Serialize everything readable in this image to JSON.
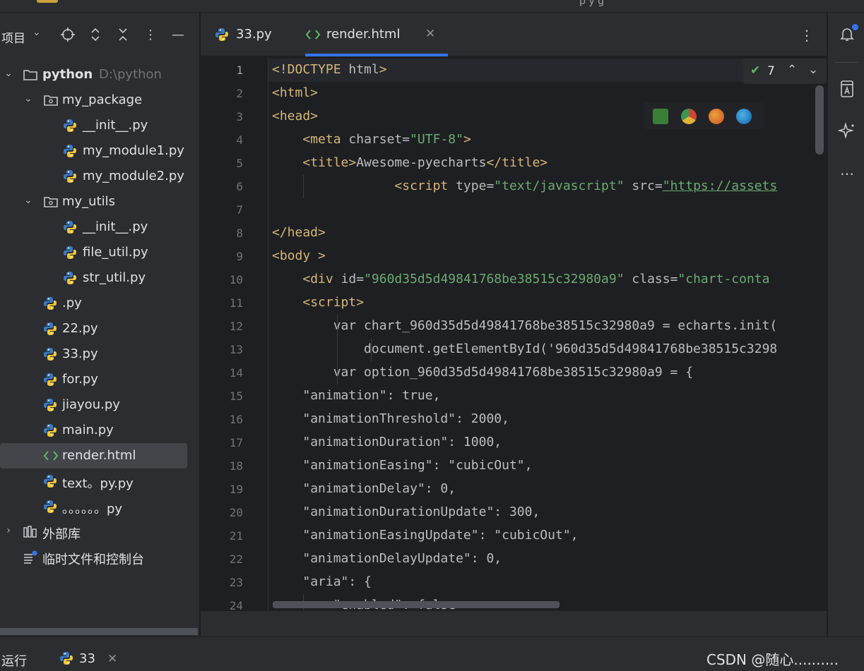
{
  "top_strip": {
    "text": "p  y  g"
  },
  "project_panel": {
    "title": "项目",
    "tree": [
      {
        "label": "python",
        "hint": "D:\\python",
        "type": "folder",
        "depth": 0,
        "expanded": true
      },
      {
        "label": "my_package",
        "type": "package",
        "depth": 1,
        "expanded": true
      },
      {
        "label": "__init__.py",
        "type": "py",
        "depth": 2
      },
      {
        "label": "my_module1.py",
        "type": "py",
        "depth": 2
      },
      {
        "label": "my_module2.py",
        "type": "py",
        "depth": 2
      },
      {
        "label": "my_utils",
        "type": "package",
        "depth": 1,
        "expanded": true
      },
      {
        "label": "__init__.py",
        "type": "py",
        "depth": 2
      },
      {
        "label": "file_util.py",
        "type": "py",
        "depth": 2
      },
      {
        "label": "str_util.py",
        "type": "py",
        "depth": 2
      },
      {
        "label": ".py",
        "type": "py",
        "depth": 1
      },
      {
        "label": "22.py",
        "type": "py",
        "depth": 1
      },
      {
        "label": "33.py",
        "type": "py",
        "depth": 1
      },
      {
        "label": "for.py",
        "type": "py",
        "depth": 1
      },
      {
        "label": "jiayou.py",
        "type": "py",
        "depth": 1
      },
      {
        "label": "main.py",
        "type": "py",
        "depth": 1
      },
      {
        "label": "render.html",
        "type": "html",
        "depth": 1,
        "selected": true
      },
      {
        "label": "text。py.py",
        "type": "py",
        "depth": 1
      },
      {
        "label": "。。。。。。py",
        "type": "py",
        "depth": 1
      },
      {
        "label": "外部库",
        "type": "library",
        "depth": 0,
        "expanded": false
      },
      {
        "label": "临时文件和控制台",
        "type": "scratch",
        "depth": 0
      }
    ]
  },
  "editor": {
    "tabs": [
      {
        "label": "33.py",
        "type": "py",
        "active": false
      },
      {
        "label": "render.html",
        "type": "html",
        "active": true
      }
    ],
    "inspection_count": "7",
    "lines": [
      {
        "n": "1",
        "ind": 0,
        "segs": [
          [
            "tag",
            "<!DOCTYPE "
          ],
          [
            "attr",
            "html"
          ],
          [
            "tag",
            ">"
          ]
        ]
      },
      {
        "n": "2",
        "ind": 0,
        "segs": [
          [
            "tag",
            "<html>"
          ]
        ]
      },
      {
        "n": "3",
        "ind": 0,
        "segs": [
          [
            "tag",
            "<head>"
          ]
        ]
      },
      {
        "n": "4",
        "ind": 4,
        "segs": [
          [
            "tag",
            "<meta "
          ],
          [
            "attr",
            "charset"
          ],
          [
            "plain",
            "="
          ],
          [
            "str",
            "\"UTF-8\""
          ],
          [
            "tag",
            ">"
          ]
        ]
      },
      {
        "n": "5",
        "ind": 4,
        "segs": [
          [
            "tag",
            "<title>"
          ],
          [
            "plain",
            "Awesome-pyecharts"
          ],
          [
            "tag",
            "</title>"
          ]
        ]
      },
      {
        "n": "6",
        "ind": 16,
        "segs": [
          [
            "tag",
            "<script "
          ],
          [
            "attr",
            "type"
          ],
          [
            "plain",
            "="
          ],
          [
            "str",
            "\"text/javascript\""
          ],
          [
            "plain",
            " "
          ],
          [
            "attr",
            "src"
          ],
          [
            "plain",
            "="
          ],
          [
            "lnk",
            "\"https://assets"
          ]
        ]
      },
      {
        "n": "7",
        "ind": 0,
        "segs": []
      },
      {
        "n": "8",
        "ind": 0,
        "segs": [
          [
            "tag",
            "</head>"
          ]
        ]
      },
      {
        "n": "9",
        "ind": 0,
        "segs": [
          [
            "tag",
            "<body "
          ],
          [
            "tag",
            ">"
          ]
        ]
      },
      {
        "n": "10",
        "ind": 4,
        "segs": [
          [
            "tag",
            "<div "
          ],
          [
            "attr",
            "id"
          ],
          [
            "plain",
            "="
          ],
          [
            "str",
            "\"960d35d5d49841768be38515c32980a9\""
          ],
          [
            "plain",
            " "
          ],
          [
            "attr",
            "class"
          ],
          [
            "plain",
            "="
          ],
          [
            "str",
            "\"chart-conta"
          ]
        ]
      },
      {
        "n": "11",
        "ind": 4,
        "segs": [
          [
            "tag",
            "<script>"
          ]
        ]
      },
      {
        "n": "12",
        "ind": 8,
        "segs": [
          [
            "plain",
            "var chart_960d35d5d49841768be38515c32980a9 = echarts.init("
          ]
        ]
      },
      {
        "n": "13",
        "ind": 12,
        "segs": [
          [
            "plain",
            "document.getElementById('960d35d5d49841768be38515c3298"
          ]
        ]
      },
      {
        "n": "14",
        "ind": 8,
        "segs": [
          [
            "plain",
            "var option_960d35d5d49841768be38515c32980a9 = {"
          ]
        ]
      },
      {
        "n": "15",
        "ind": 4,
        "segs": [
          [
            "plain",
            "\"animation\": true,"
          ]
        ]
      },
      {
        "n": "16",
        "ind": 4,
        "segs": [
          [
            "plain",
            "\"animationThreshold\": 2000,"
          ]
        ]
      },
      {
        "n": "17",
        "ind": 4,
        "segs": [
          [
            "plain",
            "\"animationDuration\": 1000,"
          ]
        ]
      },
      {
        "n": "18",
        "ind": 4,
        "segs": [
          [
            "plain",
            "\"animationEasing\": \"cubicOut\","
          ]
        ]
      },
      {
        "n": "19",
        "ind": 4,
        "segs": [
          [
            "plain",
            "\"animationDelay\": 0,"
          ]
        ]
      },
      {
        "n": "20",
        "ind": 4,
        "segs": [
          [
            "plain",
            "\"animationDurationUpdate\": 300,"
          ]
        ]
      },
      {
        "n": "21",
        "ind": 4,
        "segs": [
          [
            "plain",
            "\"animationEasingUpdate\": \"cubicOut\","
          ]
        ]
      },
      {
        "n": "22",
        "ind": 4,
        "segs": [
          [
            "plain",
            "\"animationDelayUpdate\": 0,"
          ]
        ]
      },
      {
        "n": "23",
        "ind": 4,
        "segs": [
          [
            "plain",
            "\"aria\": {"
          ]
        ]
      },
      {
        "n": "24",
        "ind": 8,
        "segs": [
          [
            "plain",
            "\"enabled\": false"
          ]
        ]
      }
    ]
  },
  "run_panel": {
    "label": "运行",
    "tab_label": "33"
  },
  "watermark": "CSDN @随心..........",
  "colors": {
    "accent": "#3574f0",
    "tag": "#d5b778",
    "string": "#6aab73",
    "python_blue": "#3d7bc4",
    "python_yellow": "#f0c63d",
    "html_green": "#5fb865"
  },
  "icons": {
    "folder": "folder-icon",
    "package": "package-icon",
    "py": "python-file-icon",
    "html": "html-file-icon",
    "library": "library-icon",
    "scratch": "scratch-icon"
  }
}
